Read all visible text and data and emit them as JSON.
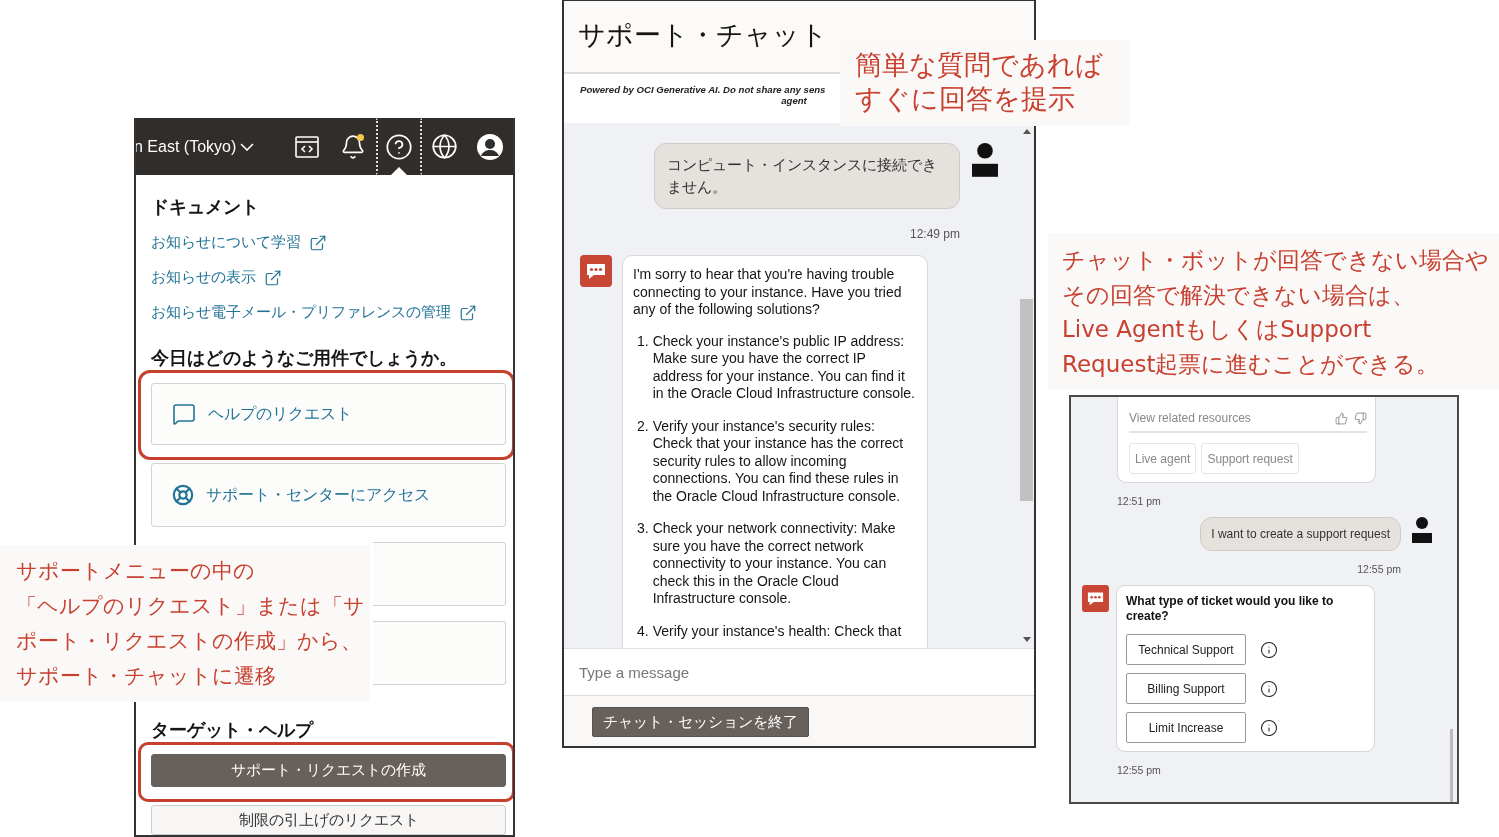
{
  "help_menu": {
    "region": "n East (Tokyo)",
    "toolbar": [
      {
        "kind": "code",
        "selected": false,
        "notification": false
      },
      {
        "kind": "bell",
        "selected": false,
        "notification": true
      },
      {
        "kind": "help",
        "selected": true,
        "notification": false
      },
      {
        "kind": "globe",
        "selected": false,
        "notification": false
      },
      {
        "kind": "avatar",
        "selected": false,
        "notification": false
      }
    ],
    "documents_heading": "ドキュメント",
    "document_links": [
      "お知らせについて学習",
      "お知らせの表示",
      "お知らせ電子メール・プリファレンスの管理"
    ],
    "question": "今日はどのようなご用件でしょうか。",
    "help_options": [
      {
        "label": "ヘルプのリクエスト",
        "highlighted": true
      },
      {
        "label": "サポート・センターにアクセス",
        "highlighted": false
      },
      {
        "highlighted": false
      },
      {
        "highlighted": false
      }
    ],
    "targeted_heading": "ターゲット・ヘルプ",
    "targeted_buttons": [
      {
        "label": "サポート・リクエストの作成",
        "primary": true,
        "highlighted": true
      },
      {
        "label": "制限の引上げのリクエスト",
        "primary": false,
        "highlighted": false
      }
    ]
  },
  "chat": {
    "title": "サポート・チャット",
    "disclaimer_lines": [
      "Powered by OCI Generative AI. Do not share any sens",
      "agent"
    ],
    "messages": [
      {
        "kind": "user",
        "text": "コンピュート・インスタンスに接続できません。"
      },
      {
        "kind": "user_time",
        "text": "12:49 pm"
      },
      {
        "kind": "bot",
        "intro": "I'm sorry to hear that you're having trouble connecting to your instance. Have you tried any of the following solutions?",
        "steps": [
          {
            "number": "1.",
            "text": "Check your instance's public IP address: Make sure you have the correct IP address for your instance. You can find it in the Oracle Cloud Infrastructure console."
          },
          {
            "number": "2.",
            "text": "Verify your instance's security rules: Check that your instance has the correct security rules to allow incoming connections. You can find these rules in the Oracle Cloud Infrastructure console."
          },
          {
            "number": "3.",
            "text": "Check your network connectivity: Make sure you have the correct network connectivity to your instance. You can check this in the Oracle Cloud Infrastructure console."
          },
          {
            "number": "4.",
            "text": "Verify your instance's health: Check that"
          }
        ]
      }
    ],
    "input": {
      "placeholder": "Type a message"
    },
    "end_button": "チャット・セッションを終了"
  },
  "chat_detail": {
    "messages": [
      {
        "kind": "resource_card",
        "link": "View related resources",
        "actions": [
          "Live agent",
          "Support request"
        ]
      },
      {
        "kind": "bot_time",
        "text": "12:51 pm"
      },
      {
        "kind": "user",
        "text": "I want to create a support request"
      },
      {
        "kind": "user_time",
        "text": "12:55 pm"
      },
      {
        "kind": "choice",
        "question": "What type of ticket would you like to create?",
        "options": [
          "Technical Support",
          "Billing Support",
          "Limit Increase"
        ]
      },
      {
        "kind": "bot_time",
        "text": "12:55 pm"
      }
    ]
  },
  "callouts": [
    {
      "lines": [
        "簡単な質問であれば",
        "すぐに回答を提示"
      ]
    },
    {
      "lines": [
        "チャット・ボットが回答できない場合や",
        "その回答で解決できない場合は、",
        "Live AgentもしくはSupport",
        "Request起票に進むことができる。"
      ]
    },
    {
      "lines": [
        "サポートメニューの中の",
        "「ヘルプのリクエスト」または「サ",
        "ポート・リクエストの作成」から、",
        "サポート・チャットに遷移"
      ]
    }
  ]
}
